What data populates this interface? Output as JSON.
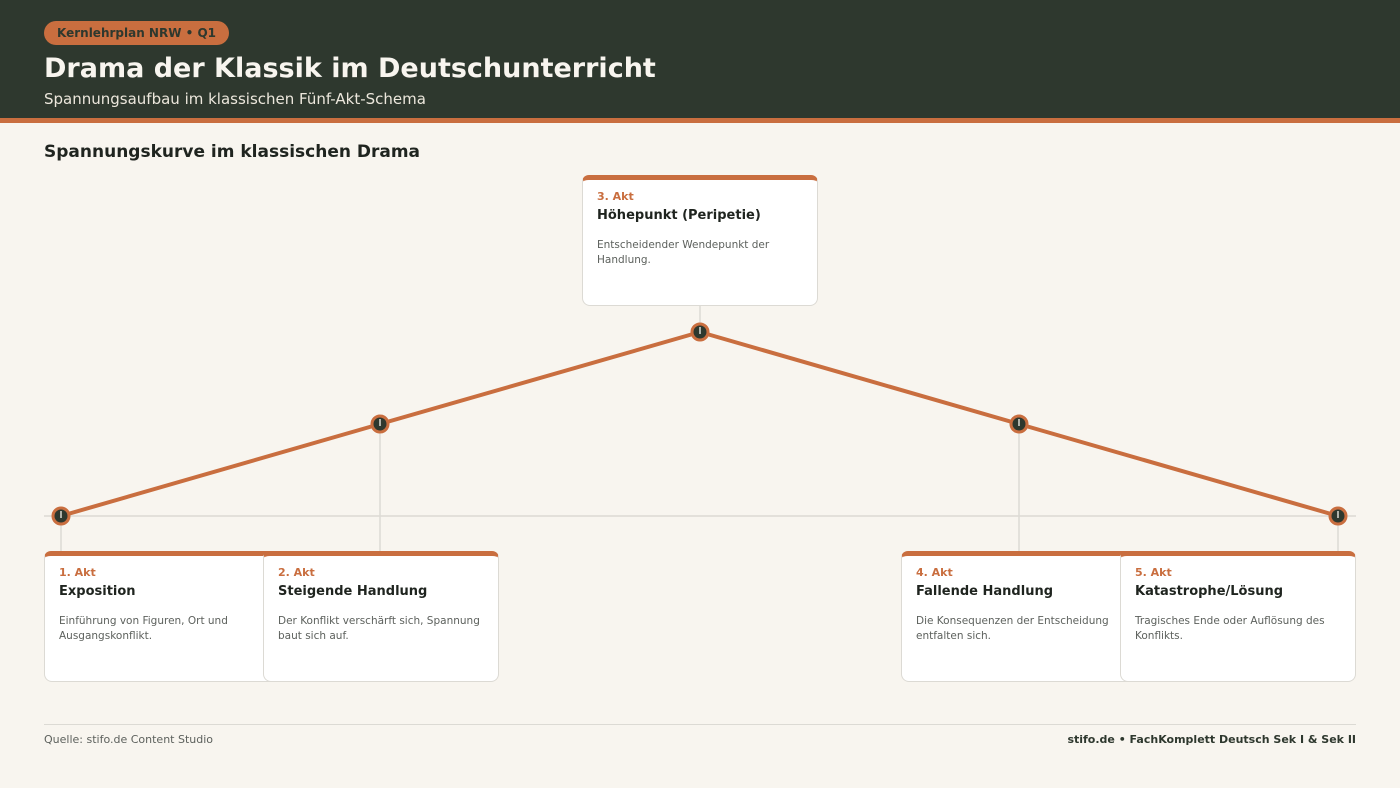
{
  "header": {
    "badge": "Kernlehrplan NRW • Q1",
    "title": "Drama der Klassik im Deutschunterricht",
    "subtitle": "Spannungsaufbau im klassischen Fünf-Akt-Schema"
  },
  "section_title": "Spannungskurve im klassischen Drama",
  "acts": [
    {
      "act": "1. Akt",
      "name": "Exposition",
      "description": "Einführung von Figuren, Ort und Ausgangskonflikt.",
      "tension_level": 0
    },
    {
      "act": "2. Akt",
      "name": "Steigende Handlung",
      "description": "Der Konflikt verschärft sich, Spannung baut sich auf.",
      "tension_level": 1
    },
    {
      "act": "3. Akt",
      "name": "Höhepunkt (Peripetie)",
      "description": "Entscheidender Wendepunkt der Handlung.",
      "tension_level": 2
    },
    {
      "act": "4. Akt",
      "name": "Fallende Handlung",
      "description": "Die Konsequenzen der Entscheidung entfalten sich.",
      "tension_level": 1
    },
    {
      "act": "5. Akt",
      "name": "Katastrophe/Lösung",
      "description": "Tragisches Ende oder Auflösung des Konflikts.",
      "tension_level": 0
    }
  ],
  "footer": {
    "source": "Quelle: stifo.de Content Studio",
    "brand": "stifo.de • FachKomplett Deutsch Sek I & Sek II"
  },
  "colors": {
    "header_bg": "#2e382e",
    "accent": "#c96e3f",
    "page_bg": "#f8f5ef",
    "card_bg": "#ffffff"
  }
}
